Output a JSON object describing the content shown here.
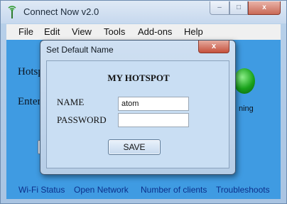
{
  "window": {
    "title": "Connect Now v2.0",
    "icon": "antenna-icon",
    "controls": {
      "minimize": "–",
      "maximize": "□",
      "close": "x"
    }
  },
  "menu": [
    "File",
    "Edit",
    "View",
    "Tools",
    "Add-ons",
    "Help"
  ],
  "background": {
    "label_hotspot": "Hotsp",
    "label_enter": "Enter",
    "status_text": "ning",
    "status_color": "#19a21b"
  },
  "footer_links": [
    "Wi-Fi Status",
    "Open Network",
    "Number of clients",
    "Troubleshoots"
  ],
  "dialog": {
    "title": "Set Default Name",
    "close": "x",
    "heading": "MY HOTSPOT",
    "name_label": "NAME",
    "name_value": "atom",
    "password_label": "PASSWORD",
    "password_value": "",
    "save_label": "SAVE"
  }
}
